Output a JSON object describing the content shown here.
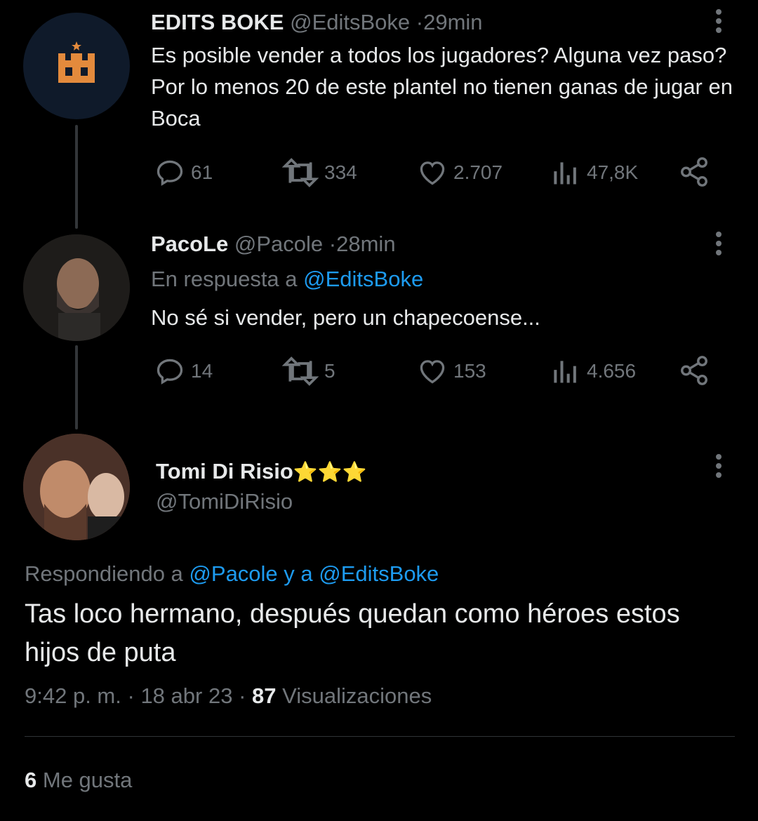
{
  "tweets": [
    {
      "name": "EDITS BOKE",
      "handle": "@EditsBoke",
      "time": "29min",
      "text": "Es posible vender a todos los jugadores? Alguna vez paso? Por lo menos 20 de este plantel no tienen ganas de jugar en Boca",
      "replies": "61",
      "retweets": "334",
      "likes": "2.707",
      "views": "47,8K"
    },
    {
      "name": "PacoLe",
      "handle": "@Pacole",
      "time": "28min",
      "reply_prefix": "En respuesta a",
      "reply_to": "@EditsBoke",
      "text": "No sé si vender, pero un chapecoense...",
      "replies": "14",
      "retweets": "5",
      "likes": "153",
      "views": "4.656"
    }
  ],
  "main_tweet": {
    "name": "Tomi Di Risio",
    "name_emoji": "⭐⭐⭐",
    "handle": "@TomiDiRisio",
    "reply_prefix": "Respondiendo a",
    "reply_to": "@Pacole y a @EditsBoke",
    "text": "Tas loco hermano, después quedan como héroes estos hijos de puta",
    "time": "9:42 p. m.",
    "date": "18 abr 23",
    "views_count": "87",
    "views_label": "Visualizaciones",
    "likes_count": "6",
    "likes_label": "Me gusta"
  },
  "separator": "·",
  "colors": {
    "background": "#000000",
    "text": "#e7e9ea",
    "muted": "#71767b",
    "link": "#1d9bf0",
    "logo_orange": "#e38a3c",
    "logo_bg": "#0f1a2a"
  }
}
